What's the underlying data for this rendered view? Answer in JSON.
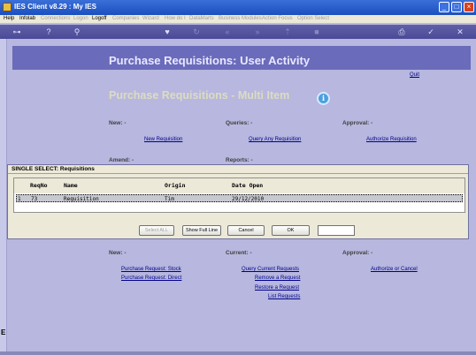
{
  "window": {
    "title": "IES Client v8.29 : My IES",
    "min": "_",
    "max": "□",
    "close": "×"
  },
  "menu": [
    {
      "label": "Help",
      "enabled": true
    },
    {
      "label": "Infolab",
      "enabled": true
    },
    {
      "label": "Connections",
      "enabled": false
    },
    {
      "label": "Logon",
      "enabled": false
    },
    {
      "label": "Logoff",
      "enabled": true
    },
    {
      "label": "Companies",
      "enabled": false
    },
    {
      "label": "Wizard",
      "enabled": false
    },
    {
      "label": "How do I",
      "enabled": false
    },
    {
      "label": "DataMarts",
      "enabled": false
    },
    {
      "label": "Business Modules",
      "enabled": false
    },
    {
      "label": "Action Focus",
      "enabled": false
    },
    {
      "label": "Option Select",
      "enabled": false
    }
  ],
  "toolbar_icons": [
    "key-icon",
    "help-icon",
    "search-icon",
    "heart-icon",
    "refresh-icon",
    "back-icon",
    "forward-icon",
    "upload-icon",
    "stop-icon",
    "print-icon",
    "check-icon",
    "close-icon"
  ],
  "page": {
    "banner_title": "Purchase Requisitions: User Activity",
    "quit": "Quit",
    "subtitle": "Purchase Requisitions - Multi Item",
    "info_icon": "i"
  },
  "upper": {
    "new_heading": "New: -",
    "queries_heading": "Queries: -",
    "approval_heading": "Approval: -",
    "new_link": "New Requisition",
    "query_link": "Query Any Requisition",
    "authorize_link": "Authorize Requisition",
    "amend_heading": "Amend: -",
    "reports_heading": "Reports: -"
  },
  "dialog": {
    "title": "SINGLE SELECT: Requisitions",
    "columns": [
      "ReqNo",
      "Name",
      "Origin",
      "Date Open"
    ],
    "rows": [
      {
        "index": "1",
        "reqno": "73",
        "name": "Requisition",
        "origin": "Tim",
        "date_open": "29/12/2010"
      }
    ],
    "buttons": {
      "select_all": "Select ALL",
      "show_full_line": "Show Full Line",
      "cancel": "Cancel",
      "ok": "OK"
    },
    "input_value": ""
  },
  "lower": {
    "new_heading": "New: -",
    "current_heading": "Current: -",
    "approval_heading": "Approval: -",
    "links_new": [
      "Purchase Request: Stock",
      "Purchase Request: Direct"
    ],
    "links_current": [
      "Query Current Requests",
      "Remove a Request",
      "Restore a Request",
      "List Requests"
    ],
    "links_approval": [
      "Authorize or Cancel"
    ]
  },
  "side_marker": "E"
}
